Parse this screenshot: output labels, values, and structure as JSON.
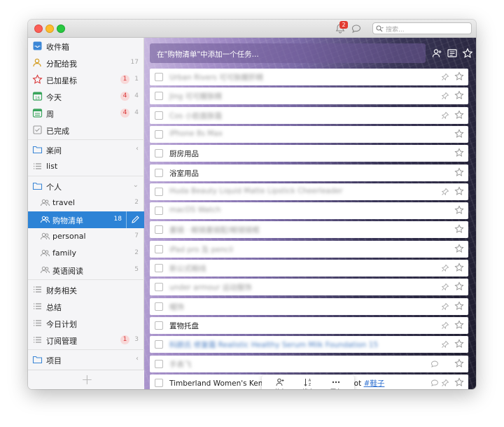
{
  "titlebar": {
    "notification_count": "2",
    "search_placeholder": "搜索..."
  },
  "sidebar": {
    "items": [
      {
        "label": "收件箱",
        "icon": "inbox-icon"
      },
      {
        "label": "分配给我",
        "count": "17",
        "icon": "assigned-user-icon"
      },
      {
        "label": "已加星标",
        "overdue": "1",
        "count": "1",
        "icon": "star-icon"
      },
      {
        "label": "今天",
        "overdue": "4",
        "count": "4",
        "icon": "calendar-today-icon"
      },
      {
        "label": "周",
        "overdue": "4",
        "count": "4",
        "icon": "calendar-week-icon"
      },
      {
        "label": "已完成",
        "icon": "checkbox-icon"
      },
      {
        "label": "楽间",
        "icon": "folder-icon"
      },
      {
        "label": "list",
        "icon": "list-icon"
      },
      {
        "label": "个人",
        "icon": "folder-icon"
      },
      {
        "label": "travel",
        "count": "2",
        "icon": "shared-list-icon"
      },
      {
        "label": "购物清单",
        "count": "18",
        "icon": "shared-list-icon"
      },
      {
        "label": "personal",
        "count": "7",
        "icon": "shared-list-icon"
      },
      {
        "label": "family",
        "count": "2",
        "icon": "shared-list-icon"
      },
      {
        "label": "英语阅读",
        "count": "5",
        "icon": "shared-list-icon"
      },
      {
        "label": "财务相关",
        "icon": "list-icon"
      },
      {
        "label": "总结",
        "icon": "list-icon"
      },
      {
        "label": "今日计划",
        "icon": "list-icon"
      },
      {
        "label": "订阅管理",
        "overdue": "1",
        "count": "3",
        "icon": "list-icon"
      },
      {
        "label": "项目",
        "icon": "folder-icon"
      }
    ],
    "add_label": "+"
  },
  "main": {
    "add_task_placeholder": "在\"购物清单\"中添加一个任务...",
    "tasks": [
      {
        "title": "Urban Rivers 可可肤醒肝精",
        "blurred": true,
        "pin": true
      },
      {
        "title": "Jing 可可醒肤精",
        "blurred": true,
        "pin": true
      },
      {
        "title": "Cos 小脸面肤霜",
        "blurred": true,
        "pin": true
      },
      {
        "title": "iPhone 8s Max",
        "blurred": true,
        "pin": false
      },
      {
        "title": "厨房用品",
        "blurred": false,
        "pin": false
      },
      {
        "title": "浴室用品",
        "blurred": false,
        "pin": false
      },
      {
        "title": "Huda Beauty Liquid Matte Lipstick Cheerleader",
        "blurred": true,
        "pin": true
      },
      {
        "title": "macOS Watch",
        "blurred": true,
        "pin": false
      },
      {
        "title": "墨镜 · 眼镜墨镜配/眼镜镜框",
        "blurred": true,
        "pin": false
      },
      {
        "title": "iPad pro 及 pencil",
        "blurred": true,
        "pin": false
      },
      {
        "title": "新公式眼线",
        "blurred": true,
        "pin": true
      },
      {
        "title": "under armour 运动服饰",
        "blurred": true,
        "pin": true
      },
      {
        "title": "帽饰",
        "blurred": true,
        "pin": true
      },
      {
        "title": "置物托盘",
        "blurred": false,
        "pin": true
      },
      {
        "title": "科颜氏 修复霜 Realistic Healthy Serum Milk Foundation 15",
        "blurred": true,
        "link": true,
        "pin": true
      },
      {
        "title": "手表飞",
        "blurred": true,
        "pin": false,
        "comment": true
      },
      {
        "title": "Timberland Women's Kenniston 6 Inch Lace Up Boot ",
        "hashtag": "#鞋子",
        "blurred": false,
        "pin": true,
        "comment": true
      }
    ],
    "toolbar": {
      "share": "共享",
      "sort": "排序",
      "more": "更多"
    }
  },
  "colors": {
    "accent": "#2d83d6",
    "overdue_badge_bg": "#f8d9d9",
    "overdue_badge_text": "#d9383a",
    "notification_badge": "#e23b30"
  }
}
